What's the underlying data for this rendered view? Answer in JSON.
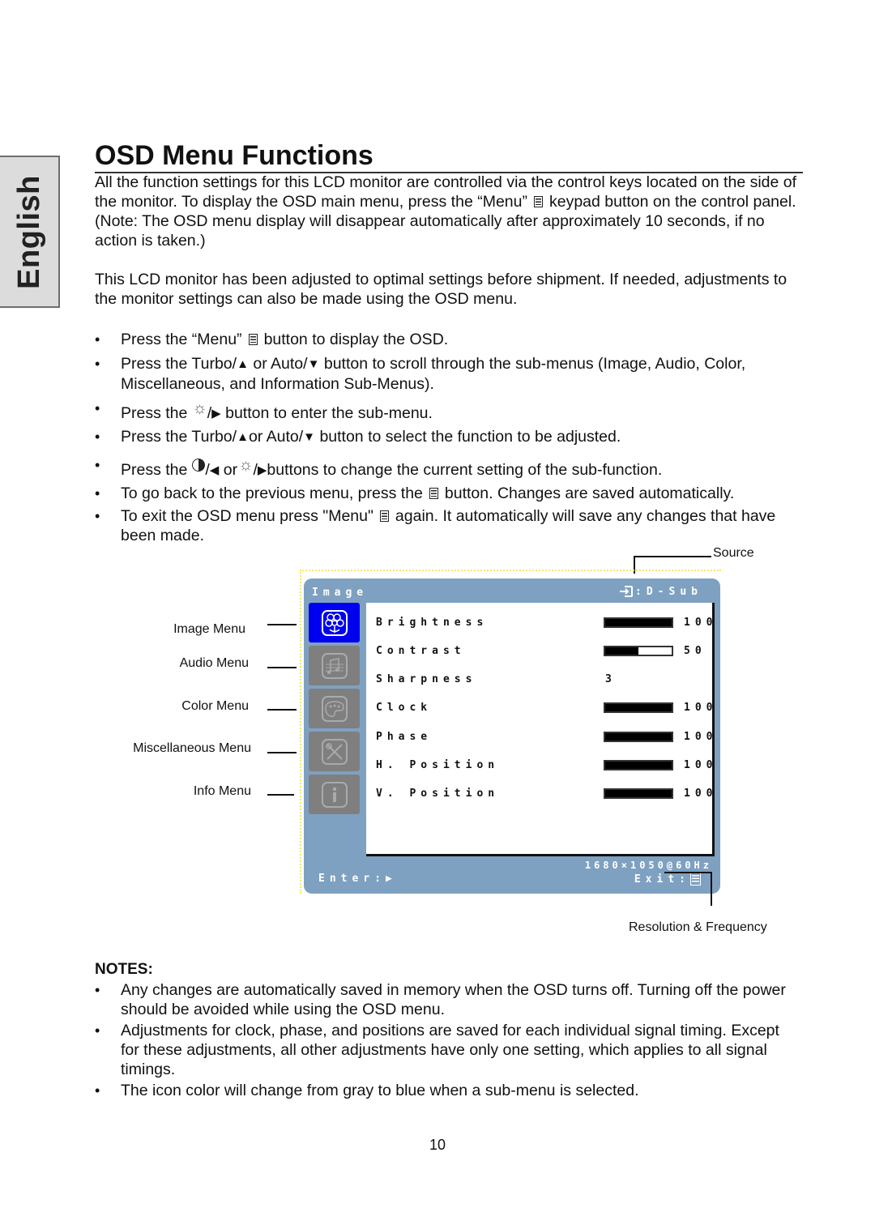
{
  "side_tab": {
    "label": "English"
  },
  "page": {
    "title": "OSD Menu Functions",
    "intro": [
      "All the function settings for this LCD monitor are controlled via the control keys located on the side of the monitor. To display the OSD main menu, press the “Menu”",
      "keypad button on the control panel. (Note: The OSD menu display will disappear automatically after approximately 10 seconds, if no action is taken.)"
    ],
    "paragraph2": "This LCD monitor has been adjusted to optimal settings before shipment. If needed, adjustments to the monitor settings can also be made using the OSD menu.",
    "bullets": [
      {
        "a": "Press the “Menu”",
        "b": "button to display the OSD."
      },
      {
        "a": "Press the Turbo/",
        "b": "or Auto/",
        "c": "button to scroll through the sub-menus (Image, Audio, Color, Miscellaneous, and Information Sub-Menus)."
      },
      {
        "a": "Press the",
        "b": "/",
        "c": "button to enter the sub-menu."
      },
      {
        "a": "Press the Turbo/",
        "b": "or Auto/",
        "c": "button to select the function to be adjusted."
      },
      {
        "a": "Press the",
        "b": "/",
        "c": "or",
        "d": "/",
        "e": "buttons to change the current setting of the sub-function."
      },
      {
        "a": "To go back to the previous menu, press the",
        "b": "button. Changes are saved automatically."
      },
      {
        "a": "To exit the OSD menu press \"Menu\"",
        "b": "again. It automatically will save any changes that have been made."
      }
    ],
    "glyphs": {
      "up": "▲",
      "down": "▼",
      "right": "▶",
      "left": "◀",
      "sun": "☼"
    },
    "notes_heading": "NOTES:",
    "notes": [
      "Any changes are automatically saved in memory when the OSD turns off. Turning off the power should be avoided while using the OSD menu.",
      "Adjustments for clock, phase, and positions are saved for each individual signal timing. Except for these adjustments, all other adjustments have only one setting, which applies to all signal timings.",
      "The icon color will change from gray to blue when a sub-menu is selected."
    ],
    "page_number": "10"
  },
  "diagram": {
    "callouts": {
      "source": "Source",
      "resolution": "Resolution & Frequency",
      "menus": [
        "Image Menu",
        "Audio  Menu",
        "Color Menu",
        "Miscellaneous Menu",
        "Info Menu"
      ]
    },
    "osd": {
      "header_title": "Image",
      "source_label": ":D-Sub",
      "source_icon": "input-source-icon",
      "side_icons": [
        {
          "name": "image-menu-icon",
          "active": true
        },
        {
          "name": "audio-menu-icon",
          "active": false
        },
        {
          "name": "color-menu-icon",
          "active": false
        },
        {
          "name": "misc-menu-icon",
          "active": false
        },
        {
          "name": "info-menu-icon",
          "active": false
        }
      ],
      "rows": [
        {
          "name": "Brightness",
          "value": "100",
          "bar": 100
        },
        {
          "name": "Contrast",
          "value": "50",
          "bar": 50
        },
        {
          "name": "Sharpness",
          "value": "3",
          "bar": null
        },
        {
          "name": "Clock",
          "value": "100",
          "bar": 100
        },
        {
          "name": "Phase",
          "value": "100",
          "bar": 100
        },
        {
          "name": "H. Position",
          "value": "100",
          "bar": 100
        },
        {
          "name": "V. Position",
          "value": "100",
          "bar": 100
        }
      ],
      "resolution": "1680×1050@60Hz",
      "enter_label": "Enter:",
      "enter_icon": "▶",
      "exit_label": "Exit:"
    },
    "colors": {
      "osd_frame": "#7fa1c1",
      "active_icon": "#0000f0",
      "inactive_icon": "#7f7f7f"
    }
  }
}
